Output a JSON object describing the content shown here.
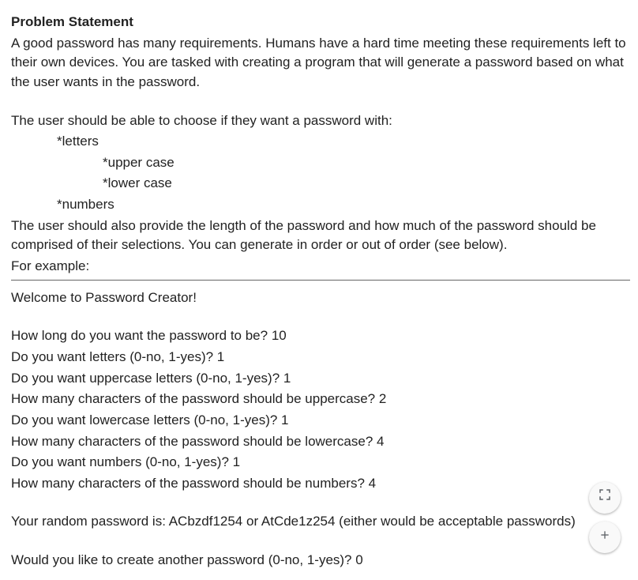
{
  "heading": "Problem Statement",
  "intro_p1": "A good password has many requirements. Humans have a hard time meeting these requirements left to their own devices. You are tasked with creating a program that will generate a password based on what the user wants in the password.",
  "choose_line": "The user should be able to choose if they want a password with:",
  "bullet_letters": "*letters",
  "bullet_upper": "*upper case",
  "bullet_lower": "*lower case",
  "bullet_numbers": "*numbers",
  "intro_p2": "The user should also provide the length of the password and how much of the password should be comprised of their selections. You can generate in order or out of order (see below).",
  "for_example": "For example:",
  "welcome": "Welcome to Password Creator!",
  "q1": "How long do you want the password to be? 10",
  "q2": "Do you want letters (0-no, 1-yes)? 1",
  "q3": "Do you want uppercase letters (0-no, 1-yes)? 1",
  "q4": "How many characters of the password should be uppercase? 2",
  "q5": "Do you want lowercase letters (0-no, 1-yes)? 1",
  "q6": "How many characters of the password should be lowercase? 4",
  "q7": "Do you want numbers (0-no, 1-yes)? 1",
  "q8": "How many characters of the password should be numbers? 4",
  "result": "Your random password is: ACbzdf1254 or AtCde1z254 (either would be acceptable passwords)",
  "again": "Would you like to create another password (0-no, 1-yes)? 0",
  "icons": {
    "fit": "fit-to-window-icon",
    "plus": "zoom-in-icon"
  }
}
